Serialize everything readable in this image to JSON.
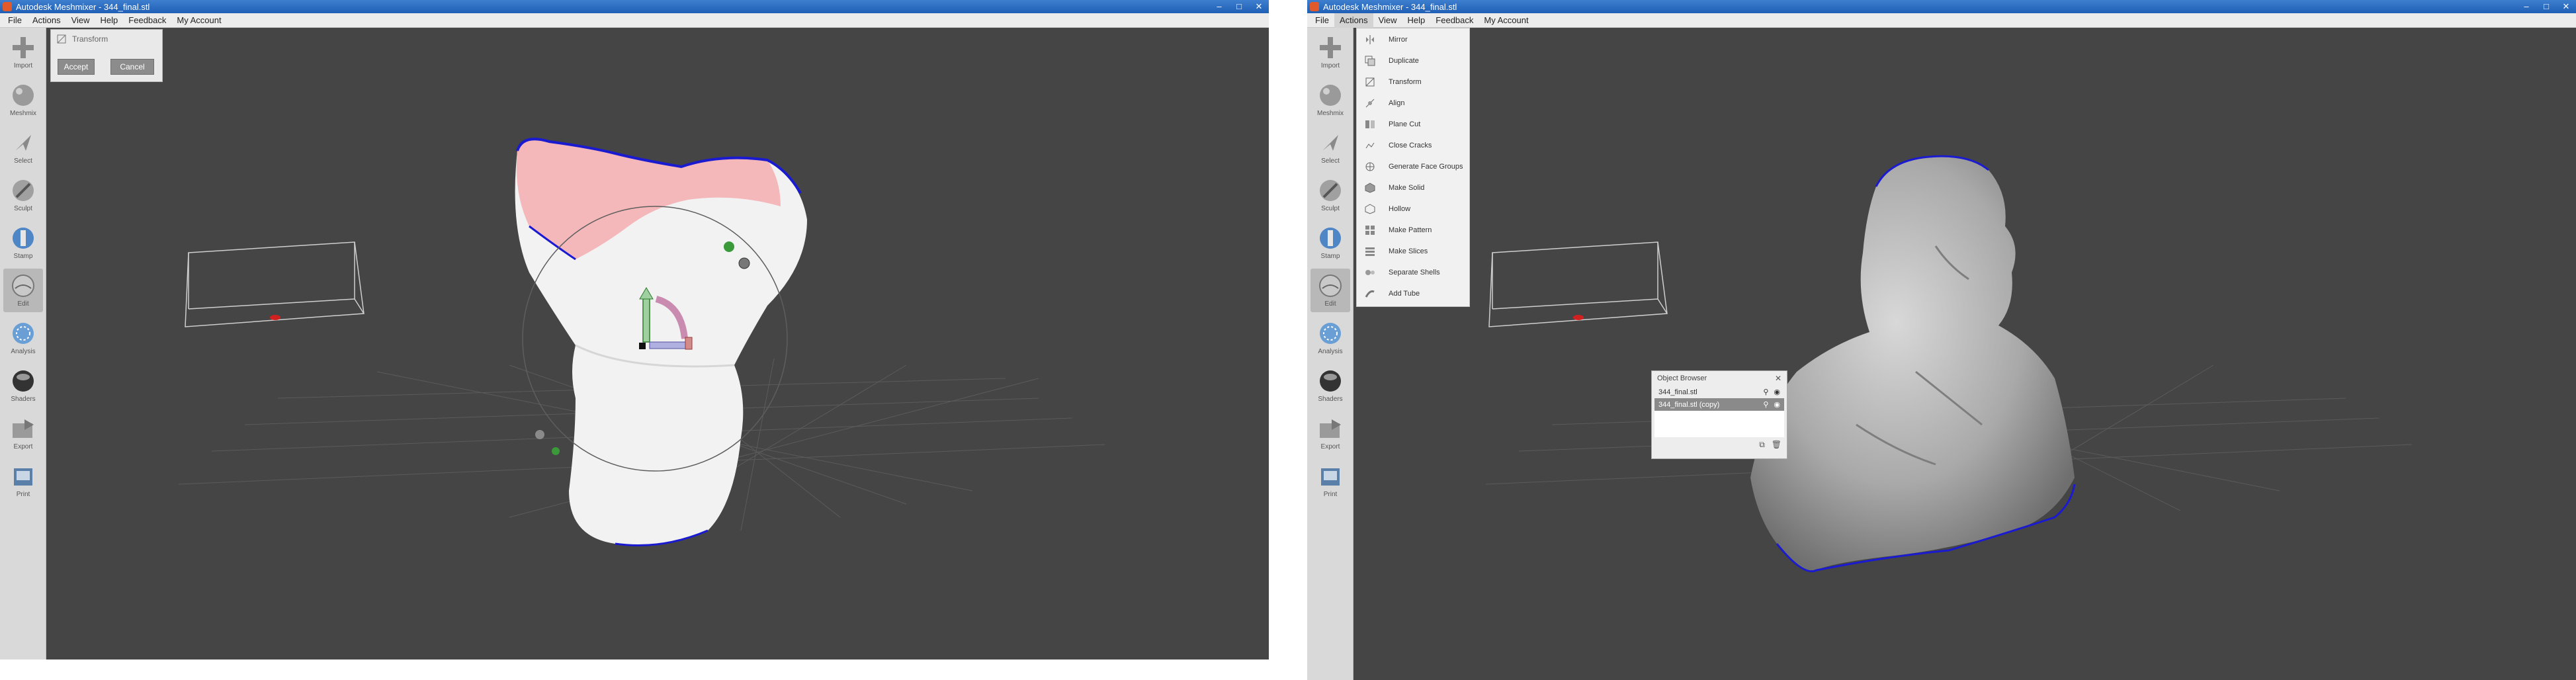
{
  "left": {
    "title": "Autodesk Meshmixer - 344_final.stl",
    "window_controls": [
      "–",
      "□",
      "✕"
    ],
    "menu": [
      "File",
      "Actions",
      "View",
      "Help",
      "Feedback",
      "My Account"
    ],
    "tools": [
      "Import",
      "Meshmix",
      "Select",
      "Sculpt",
      "Stamp",
      "Edit",
      "Analysis",
      "Shaders",
      "Export",
      "Print"
    ],
    "active_tool": "Edit",
    "transform_panel": {
      "title": "Transform",
      "accept_label": "Accept",
      "cancel_label": "Cancel"
    }
  },
  "right": {
    "title": "Autodesk Meshmixer - 344_final.stl",
    "window_controls": [
      "–",
      "□",
      "✕"
    ],
    "menu": [
      "File",
      "Actions",
      "View",
      "Help",
      "Feedback",
      "My Account"
    ],
    "tools": [
      "Import",
      "Meshmix",
      "Select",
      "Sculpt",
      "Stamp",
      "Edit",
      "Analysis",
      "Shaders",
      "Export",
      "Print"
    ],
    "active_menu": "Actions",
    "actions_menu": [
      {
        "label": "Mirror",
        "icon": "mirror-icon"
      },
      {
        "label": "Duplicate",
        "icon": "duplicate-icon"
      },
      {
        "label": "Transform",
        "icon": "transform-icon"
      },
      {
        "label": "Align",
        "icon": "align-icon"
      },
      {
        "label": "Plane Cut",
        "icon": "plane-cut-icon"
      },
      {
        "label": "Close Cracks",
        "icon": "close-cracks-icon"
      },
      {
        "label": "Generate Face Groups",
        "icon": "face-groups-icon"
      },
      {
        "label": "Make Solid",
        "icon": "make-solid-icon"
      },
      {
        "label": "Hollow",
        "icon": "hollow-icon"
      },
      {
        "label": "Make Pattern",
        "icon": "make-pattern-icon"
      },
      {
        "label": "Make Slices",
        "icon": "make-slices-icon"
      },
      {
        "label": "Separate Shells",
        "icon": "separate-shells-icon"
      },
      {
        "label": "Add Tube",
        "icon": "add-tube-icon"
      }
    ],
    "object_browser": {
      "title": "Object Browser",
      "objects": [
        {
          "name": "344_final.stl",
          "selected": false
        },
        {
          "name": "344_final.stl (copy)",
          "selected": true
        }
      ]
    }
  },
  "colors": {
    "viewport": "#454545",
    "toolbar": "#d9d9d9",
    "title_blue": "#2a6bc2",
    "boundary_blue": "#1a1ad0",
    "selection_pink": "#f1a8ad",
    "widget_green": "#3a9a3a"
  }
}
